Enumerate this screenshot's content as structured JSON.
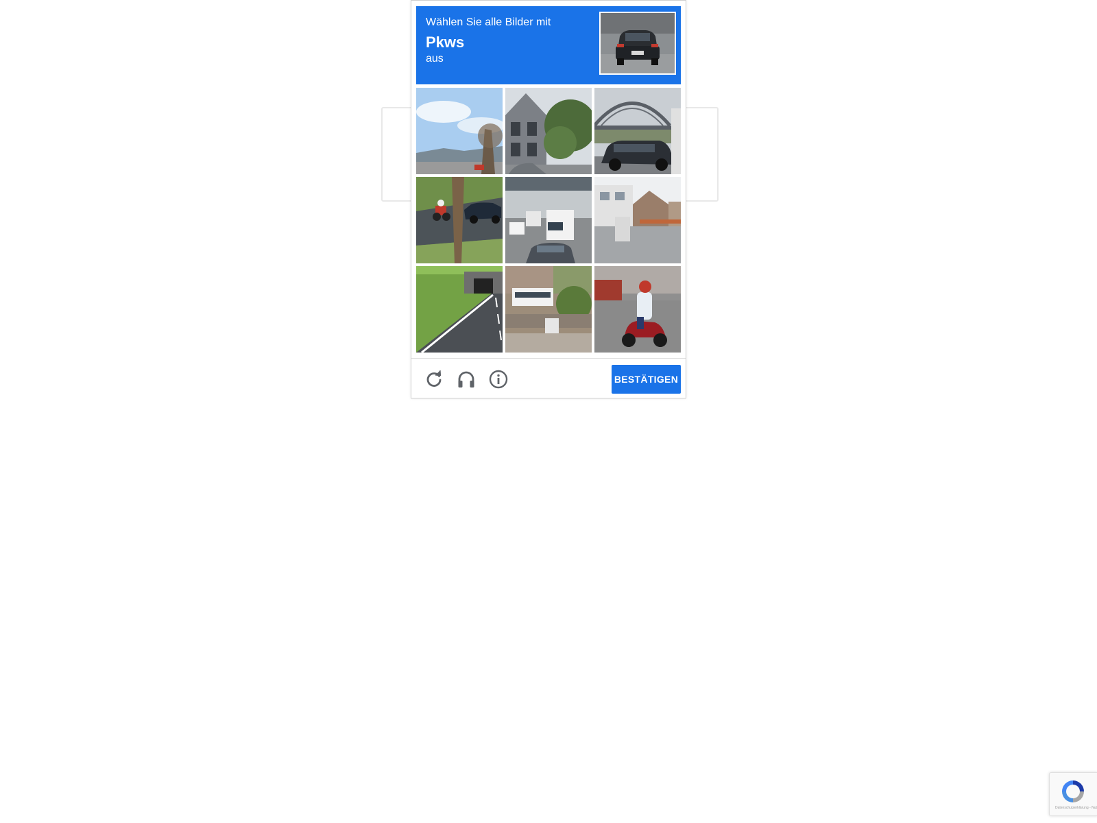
{
  "challenge": {
    "instruction_line1": "Wählen Sie alle Bilder mit",
    "target_object": "Pkws",
    "instruction_line3": "aus",
    "accent_color": "#1a73e8",
    "sample_image": "car-rear-sample",
    "tiles": [
      {
        "image": "street-sky-trees"
      },
      {
        "image": "house-tree-street"
      },
      {
        "image": "bridge-suv"
      },
      {
        "image": "motorcycle-palm-car"
      },
      {
        "image": "highway-trucks"
      },
      {
        "image": "houses-street"
      },
      {
        "image": "road-underpass"
      },
      {
        "image": "buses-building"
      },
      {
        "image": "scooter-rider"
      }
    ]
  },
  "footer": {
    "reload_icon": "reload-icon",
    "audio_icon": "headphones-icon",
    "info_icon": "info-icon",
    "verify_label": "BESTÄTIGEN"
  },
  "badge": {
    "logo_icon": "recaptcha-logo-icon",
    "terms_line": "Datenschutzerklärung - Nutzungsbedingungen"
  }
}
